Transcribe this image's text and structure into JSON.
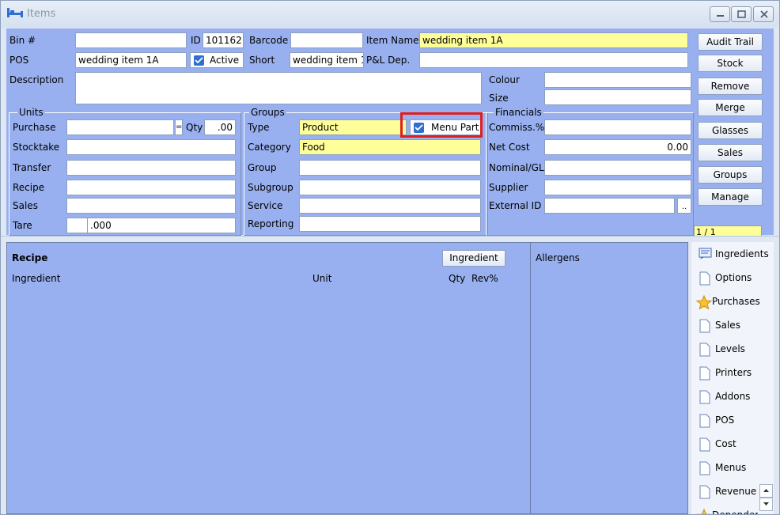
{
  "window": {
    "title": "Items"
  },
  "main": {
    "bin_label": "Bin #",
    "bin_value": "",
    "id_label": "ID",
    "id_value": "101162",
    "barcode_label": "Barcode",
    "barcode_value": "",
    "item_name_label": "Item Name",
    "item_name_value": "wedding item 1A",
    "pos_label": "POS",
    "pos_value": "wedding item 1A",
    "active_label": "Active",
    "active_checked": true,
    "short_label": "Short",
    "short_value": "wedding item 1",
    "pl_dep_label": "P&L Dep.",
    "pl_dep_value": "",
    "description_label": "Description",
    "description_value": "",
    "colour_label": "Colour",
    "colour_value": "",
    "size_label": "Size",
    "size_value": ""
  },
  "units": {
    "title": "Units",
    "purchase_label": "Purchase",
    "purchase_value": "",
    "equals": "=",
    "qty_label": "Qty",
    "qty_value": ".00",
    "stocktake_label": "Stocktake",
    "stocktake_value": "",
    "transfer_label": "Transfer",
    "transfer_value": "",
    "recipe_label": "Recipe",
    "recipe_value": "",
    "sales_label": "Sales",
    "sales_value": "",
    "tare_label": "Tare",
    "tare_value": ".000"
  },
  "groups": {
    "title": "Groups",
    "type_label": "Type",
    "type_value": "Product",
    "menu_part_label": "Menu Part",
    "menu_part_checked": true,
    "category_label": "Category",
    "category_value": "Food",
    "group_label": "Group",
    "group_value": "",
    "subgroup_label": "Subgroup",
    "subgroup_value": "",
    "service_label": "Service",
    "service_value": "",
    "reporting_label": "Reporting",
    "reporting_value": ""
  },
  "financials": {
    "title": "Financials",
    "commiss_label": "Commiss.%",
    "commiss_value": "",
    "net_cost_label": "Net Cost",
    "net_cost_value": "0.00",
    "nominal_label": "Nominal/GL",
    "nominal_value": "",
    "supplier_label": "Supplier",
    "supplier_value": "",
    "external_id_label": "External ID",
    "external_id_value": "",
    "browse_label": ".."
  },
  "right_buttons": [
    "Audit Trail",
    "Stock",
    "Remove",
    "Merge",
    "Glasses",
    "Sales",
    "Groups",
    "Manage"
  ],
  "record_counter": "1 / 1",
  "recipe": {
    "title": "Recipe",
    "ingredient_button": "Ingredient",
    "col_ingredient": "Ingredient",
    "col_unit": "Unit",
    "col_qty": "Qty",
    "col_rev": "Rev%"
  },
  "allergens": {
    "title": "Allergens"
  },
  "side_tabs": [
    {
      "label": "Ingredients",
      "icon": "ingredients-icon"
    },
    {
      "label": "Options",
      "icon": "page-icon"
    },
    {
      "label": "Purchases",
      "icon": "star-icon"
    },
    {
      "label": "Sales",
      "icon": "page-icon"
    },
    {
      "label": "Levels",
      "icon": "page-icon"
    },
    {
      "label": "Printers",
      "icon": "page-icon"
    },
    {
      "label": "Addons",
      "icon": "page-icon"
    },
    {
      "label": "POS",
      "icon": "page-icon"
    },
    {
      "label": "Cost",
      "icon": "page-icon"
    },
    {
      "label": "Menus",
      "icon": "page-icon"
    },
    {
      "label": "Revenue",
      "icon": "page-icon"
    },
    {
      "label": "Depender",
      "icon": "star-icon"
    }
  ],
  "colors": {
    "panel_bg": "#98b0ef",
    "required_field": "#ffff99",
    "highlight_box": "#e01e1e",
    "checkbox": "#2f6fd1"
  }
}
